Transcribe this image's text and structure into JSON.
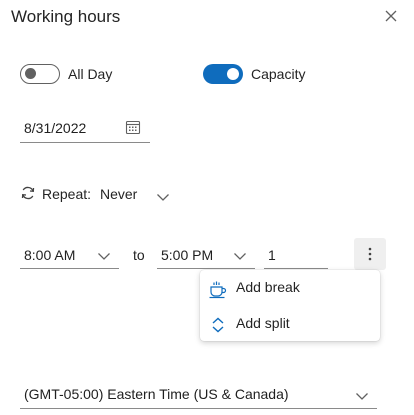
{
  "header": {
    "title": "Working hours",
    "close_icon": "close-icon"
  },
  "toggles": {
    "all_day": {
      "label": "All Day",
      "state": "off"
    },
    "capacity": {
      "label": "Capacity",
      "state": "on"
    }
  },
  "colors": {
    "accent": "#0f6cbd",
    "border": "#8a8a8a",
    "text": "#242424"
  },
  "date": {
    "value": "8/31/2022",
    "icon": "calendar-icon"
  },
  "repeat": {
    "icon": "repeat-icon",
    "label": "Repeat:",
    "value": "Never"
  },
  "times": {
    "start": "8:00 AM",
    "separator": "to",
    "end": "5:00 PM",
    "capacity": "1",
    "more_icon": "more-vertical-icon"
  },
  "menu": {
    "items": [
      {
        "label": "Add break",
        "icon": "coffee-cup-icon"
      },
      {
        "label": "Add split",
        "icon": "split-chevrons-icon"
      }
    ]
  },
  "timezone": {
    "value": "(GMT-05:00) Eastern Time (US & Canada)"
  }
}
